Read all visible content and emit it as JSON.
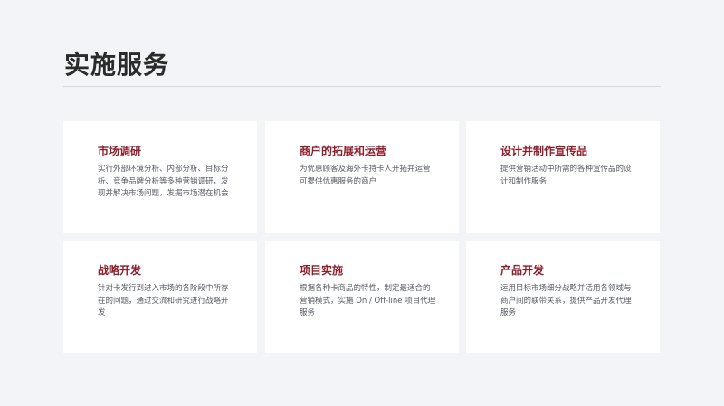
{
  "page": {
    "title": "实施服务"
  },
  "services": [
    {
      "title": "市场调研",
      "description": "实行外部环境分析、内部分析、目标分析、竞争品牌分析等多种营销调研，发现并解决市场问题，发掘市场潜在机会"
    },
    {
      "title": "商户的拓展和运营",
      "description": "为优惠顾客及海外卡持卡人开拓并运营可提供优惠服务的商户"
    },
    {
      "title": "设计并制作宣传品",
      "description": "提供营销活动中所需的各种宣传品的设计和制作服务"
    },
    {
      "title": "战略开发",
      "description": "针对卡发行到进入市场的各阶段中所存在的问题，通过交流和研究进行战略开发"
    },
    {
      "title": "项目实施",
      "description": "根据各种卡商品的特性，制定最适合的营销模式，实施 On / Off-line 项目代理服务"
    },
    {
      "title": "产品开发",
      "description": "运用目标市场细分战略并活用各领域与商户间的联带关系，提供产品开发代理服务"
    }
  ]
}
